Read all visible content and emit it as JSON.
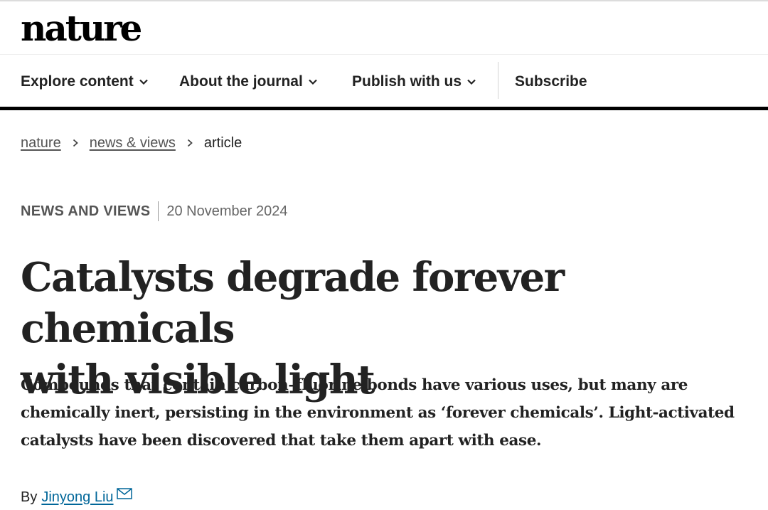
{
  "site": {
    "logo": "nature"
  },
  "nav": {
    "items": [
      {
        "label": "Explore content",
        "has_dropdown": true
      },
      {
        "label": "About the journal",
        "has_dropdown": true
      },
      {
        "label": "Publish with us",
        "has_dropdown": true
      },
      {
        "label": "Subscribe",
        "has_dropdown": false
      }
    ]
  },
  "breadcrumb": {
    "items": [
      {
        "label": "nature",
        "link": true
      },
      {
        "label": "news & views",
        "link": true
      },
      {
        "label": "article",
        "link": false
      }
    ]
  },
  "article": {
    "type": "NEWS AND VIEWS",
    "date": "20 November 2024",
    "title_line1": "Catalysts degrade forever chemicals",
    "title_line2": "with visible light",
    "standfirst_line1": "Compounds that contain carbon–fluorine bonds have various uses, but many are",
    "standfirst_line2": "chemically inert, persisting in the environment as ‘forever chemicals’. Light-activated",
    "standfirst_line3": "catalysts have been discovered that take them apart with ease.",
    "byline_prefix": "By",
    "author": "Jinyong Liu"
  },
  "colors": {
    "text": "#222222",
    "link": "#006699",
    "nav_rule": "#000000",
    "muted": "#666666"
  },
  "icons": [
    "chevron-down-icon",
    "chevron-right-icon",
    "mail-icon"
  ]
}
